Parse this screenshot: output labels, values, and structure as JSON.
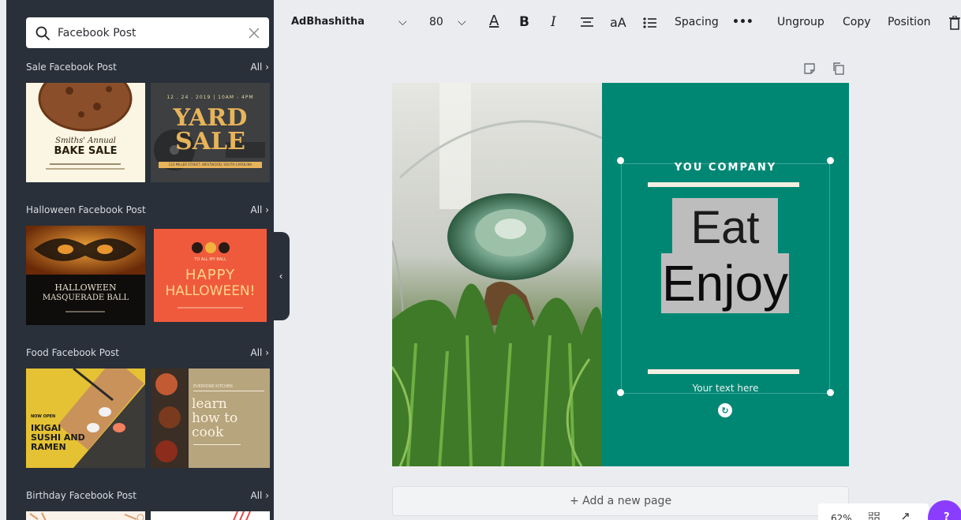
{
  "search": {
    "value": "Facebook Post",
    "icon": "search-icon",
    "clear_icon": "close-icon"
  },
  "sections": [
    {
      "title": "Sale Facebook Post",
      "all": "All"
    },
    {
      "title": "Halloween Facebook Post",
      "all": "All"
    },
    {
      "title": "Food Facebook Post",
      "all": "All"
    },
    {
      "title": "Birthday Facebook Post",
      "all": "All"
    }
  ],
  "thumbs": {
    "bake": {
      "small": "Smiths' Annual",
      "big": "BAKE SALE"
    },
    "yard": {
      "date": "12 . 24 . 2019 | 10AM - 4PM",
      "line1": "YARD",
      "line2": "SALE",
      "foot": "123 MILLER STREET, WESTWOOD, SOUTH CAROLINA"
    },
    "masq": {
      "top": "HALLOWEEN",
      "bottom": "MASQUERADE BALL"
    },
    "happy": {
      "small": "TO ALL MY BALL",
      "line1": "HAPPY",
      "line2": "HALLOWEEN!"
    },
    "sushi": {
      "small": "NOW OPEN",
      "line1": "IKIGAI",
      "line2": "SUSHI AND",
      "line3": "RAMEN"
    },
    "cook": {
      "small": "EVERYONE KITCHEN",
      "line1": "learn",
      "line2": "how to",
      "line3": "cook"
    }
  },
  "toolbar": {
    "font": "AdBhashitha",
    "size": "80",
    "text_color_glyph": "A",
    "bold_glyph": "B",
    "italic_glyph": "I",
    "case_glyph": "aA",
    "spacing": "Spacing",
    "more": "•••",
    "ungroup": "Ungroup",
    "copy": "Copy",
    "position": "Position"
  },
  "design": {
    "company": "YOU COMPANY",
    "line1": "Eat &",
    "line2": "Enjoy",
    "sub": "Your text here",
    "panel_color": "#008774"
  },
  "add_page": "+ Add a new page",
  "zoom": "62%",
  "help_label": "?"
}
